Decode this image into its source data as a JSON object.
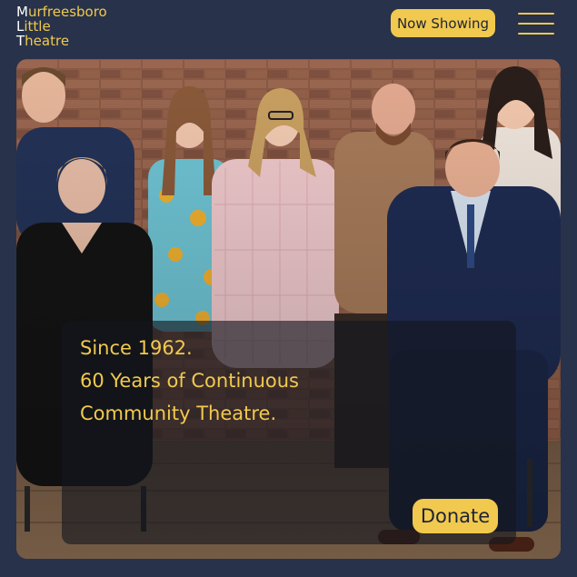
{
  "header": {
    "logo_lines": [
      {
        "initial": "M",
        "rest": "urfreesboro"
      },
      {
        "initial": "L",
        "rest": "ittle"
      },
      {
        "initial": "T",
        "rest": "heatre"
      }
    ],
    "now_showing_label": "Now Showing",
    "menu_icon": "hamburger-menu-icon"
  },
  "hero": {
    "image": "cast-group-photo",
    "tagline": [
      "Since 1962.",
      "60 Years of Continuous",
      "Community Theatre."
    ],
    "donate_label": "Donate"
  },
  "colors": {
    "background": "#28324a",
    "accent": "#f1c94e",
    "button_text": "#1e2436"
  }
}
